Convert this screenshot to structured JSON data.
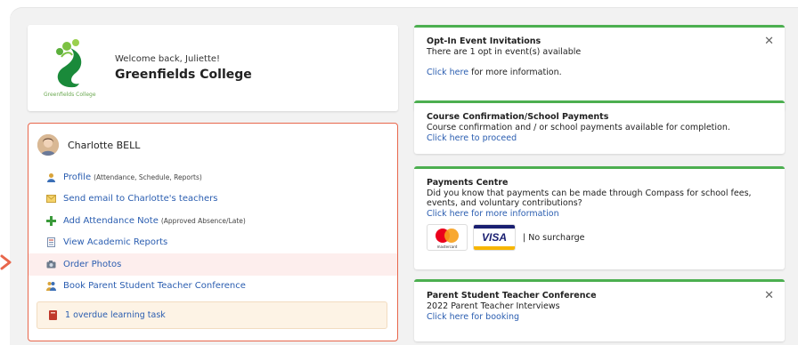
{
  "school": {
    "welcome": "Welcome back, Juliette!",
    "name": "Greenfields College",
    "logo_caption": "Greenfields College"
  },
  "student": {
    "name": "Charlotte BELL",
    "menu": [
      {
        "label": "Profile",
        "sub": "(Attendance, Schedule, Reports)",
        "icon": "user-icon"
      },
      {
        "label": "Send email to Charlotte's teachers",
        "sub": "",
        "icon": "envelope-icon"
      },
      {
        "label": "Add Attendance Note",
        "sub": "(Approved Absence/Late)",
        "icon": "plus-icon"
      },
      {
        "label": "View Academic Reports",
        "sub": "",
        "icon": "document-icon"
      },
      {
        "label": "Order Photos",
        "sub": "",
        "icon": "camera-icon"
      },
      {
        "label": "Book Parent Student Teacher Conference",
        "sub": "",
        "icon": "conference-icon"
      }
    ],
    "task": "1 overdue learning task"
  },
  "notices": {
    "event": {
      "title": "Opt-In Event Invitations",
      "line": "There are 1 opt in event(s) available",
      "link": "Click here",
      "link_suffix": " for more information."
    },
    "course": {
      "title": "Course Confirmation/School Payments",
      "line": "Course confirmation and / or school payments available for completion.",
      "link": "Click here to proceed"
    },
    "payments": {
      "title": "Payments Centre",
      "line": "Did you know that payments can be made through Compass for school fees, events, and voluntary contributions?",
      "link": "Click here for more information",
      "mastercard_text": "mastercard",
      "visa_text": "VISA",
      "surcharge": "|  No surcharge"
    },
    "conference": {
      "title": "Parent Student Teacher Conference",
      "line": "2022 Parent Teacher Interviews",
      "link": "Click here for booking"
    }
  },
  "colors": {
    "accent_green": "#4caf50",
    "highlight_border": "#e8674c",
    "link_blue": "#2a5db0"
  }
}
